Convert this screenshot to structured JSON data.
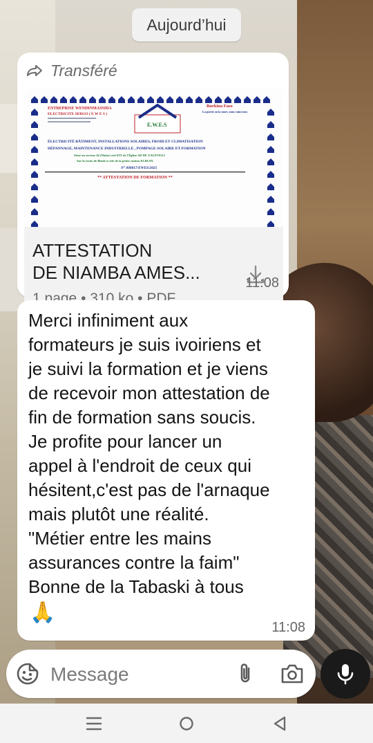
{
  "header": {
    "date_chip": "Aujourd’hui"
  },
  "messages": [
    {
      "type": "document",
      "forwarded_label": "Transféré",
      "preview": {
        "company_left_1": "ENTREPRISE WENDINMASSIDA",
        "company_left_2": "ELECTRICITE SEBGO ( E W E S )",
        "logo_text": "E.W.E.S",
        "country": "Burkina Faso",
        "motto": "La patrie ou la mort, nous vaincrons",
        "services_line_1": "ÉLECTRICITÉ BÂTIMENT, INSTALLATIONS SOLAIRES, FROID ET CLIMATISATION",
        "services_line_2": "DÉPANNAGE, MAINTENANCE INDUSTRIELLE , POMPAGE SOLAIRE ET FORMATION",
        "address_line_1": "Situé au secteur 44 (Nioko) cité EIT de l'Église AD DE ZAGTOULI",
        "address_line_2": "Sur la route de Bindé à côté de la petite station ELIKAN.",
        "reference": "N° 000817/EWES/2025",
        "attestation_heading": "** ATTESTATION DE FORMATION **"
      },
      "title_line_1": "ATTESTATION",
      "title_line_2": "DE NIAMBA AMES...",
      "meta": "1 page • 310 ko • PDF",
      "time": "11:08"
    },
    {
      "type": "text",
      "text": "Merci infiniment aux\nformateurs je suis ivoiriens et\nje suivi la formation et je viens\nde recevoir mon attestation de\nfin de formation sans soucis.\nJe profite pour lancer un\nappel à l'endroit de ceux qui\nhésitent,c'est pas de l'arnaque\nmais plutôt une réalité.\n\"Métier entre les mains\nassurances contre la faim\"\nBonne de la Tabaski à tous",
      "emoji": "🙏",
      "time": "11:08"
    }
  ],
  "composer": {
    "placeholder": "Message",
    "value": ""
  },
  "icons": {
    "forward": "forward-icon",
    "download": "download-icon",
    "emoji": "emoji-icon",
    "attach": "paperclip-icon",
    "camera": "camera-icon",
    "mic": "microphone-icon",
    "nav_menu": "recent-apps-icon",
    "nav_home": "home-icon",
    "nav_back": "back-icon"
  },
  "colors": {
    "bubble": "#ffffff",
    "doc_panel": "#f2f2f2",
    "mic_button": "#1a1a1a",
    "preview_red": "#c0202a",
    "preview_blue": "#1a2d8a",
    "preview_green": "#1f7a32"
  }
}
